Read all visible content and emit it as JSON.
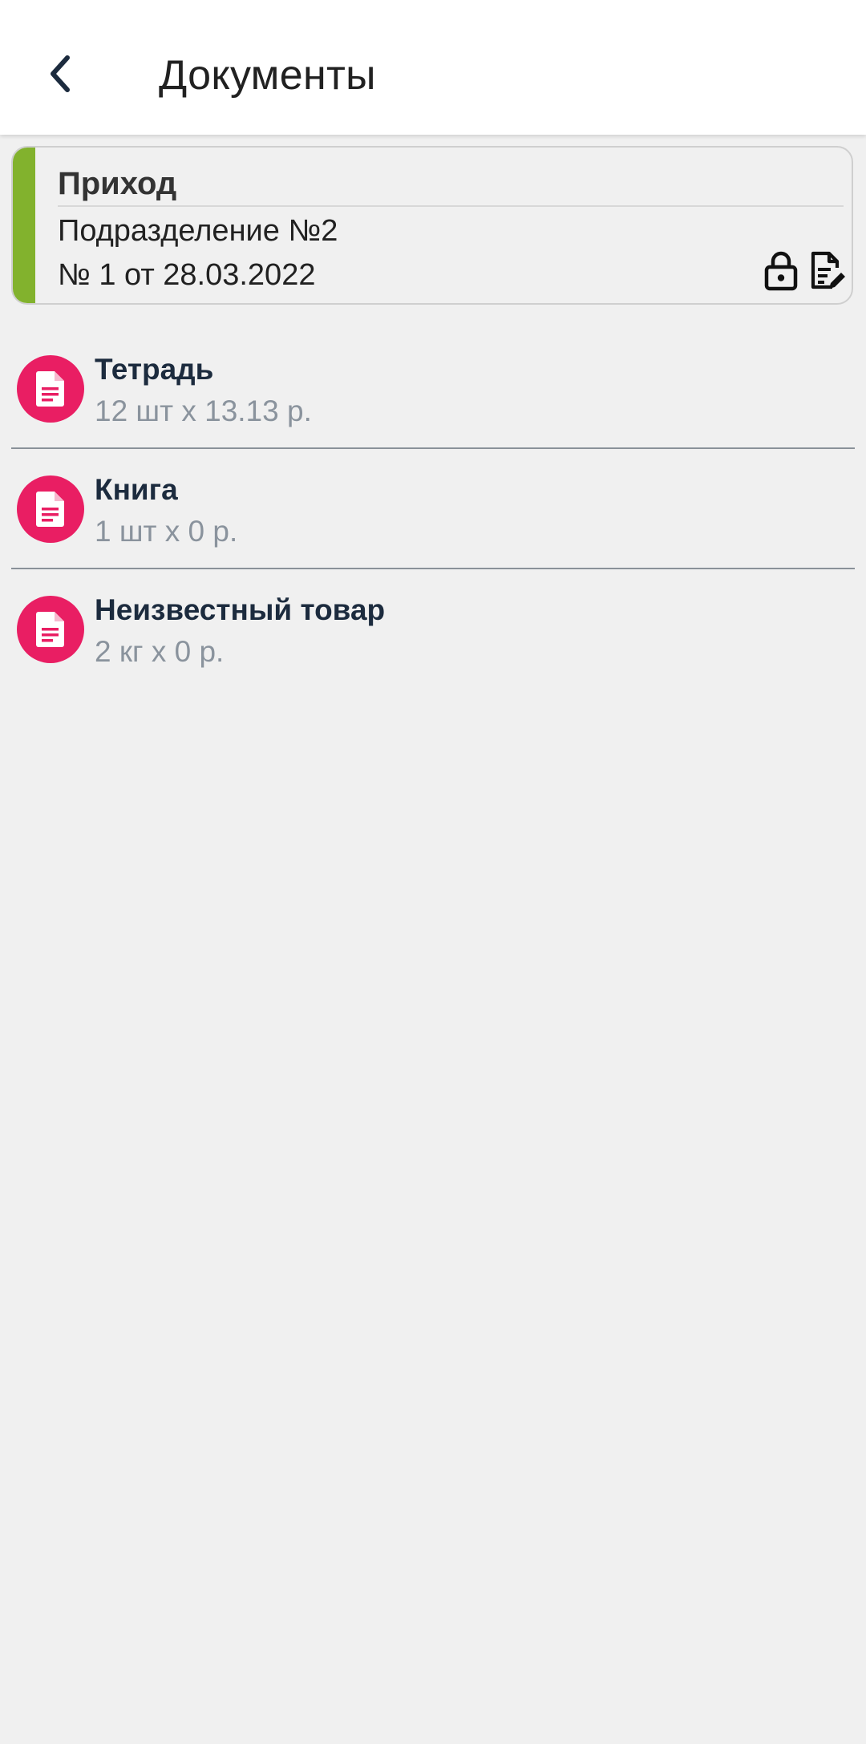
{
  "header": {
    "title": "Документы",
    "back_icon": "chevron-left-icon"
  },
  "document": {
    "type": "Приход",
    "department": "Подразделение №2",
    "number_line": "№ 1 от 28.03.2022",
    "accent_color": "#82b22d",
    "lock_icon": "lock-icon",
    "edit_icon": "document-edit-icon"
  },
  "items": [
    {
      "name": "Тетрадь",
      "quantity": "12 шт x 13.13 р.",
      "icon": "document-icon"
    },
    {
      "name": "Книга",
      "quantity": "1 шт x 0 р.",
      "icon": "document-icon"
    },
    {
      "name": "Неизвестный товар",
      "quantity": "2 кг x 0 р.",
      "icon": "document-icon"
    }
  ],
  "colors": {
    "item_icon_bg": "#e91e63",
    "item_title": "#1c2b3e",
    "item_subtitle": "#8a939d",
    "background": "#f0f0f0"
  }
}
